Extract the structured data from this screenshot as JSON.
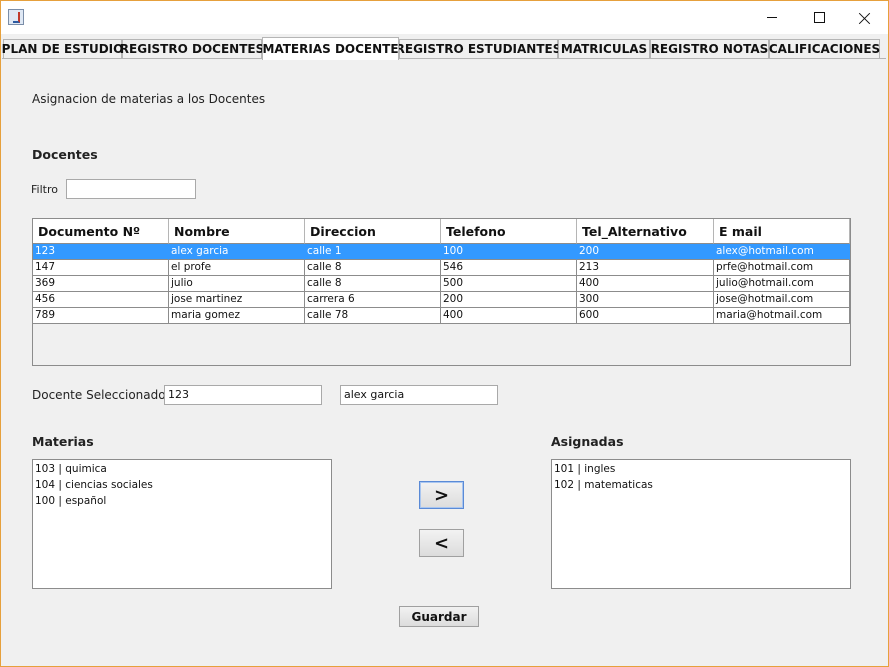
{
  "tabs": [
    {
      "label": "PLAN DE ESTUDIO",
      "active": false
    },
    {
      "label": "REGISTRO DOCENTES",
      "active": false
    },
    {
      "label": "MATERIAS DOCENTE",
      "active": true
    },
    {
      "label": "REGISTRO ESTUDIANTES",
      "active": false
    },
    {
      "label": "MATRICULAS",
      "active": false
    },
    {
      "label": "REGISTRO NOTAS",
      "active": false
    },
    {
      "label": "CALIFICACIONES",
      "active": false
    }
  ],
  "header": {
    "description": "Asignacion de materias a los Docentes",
    "docentes_label": "Docentes",
    "filter_label": "Filtro",
    "filter_value": ""
  },
  "table": {
    "columns": [
      "Documento Nº",
      "Nombre",
      "Direccion",
      "Telefono",
      "Tel_Alternativo",
      "E mail"
    ],
    "rows": [
      [
        "123",
        "alex garcia",
        "calle 1",
        "100",
        "200",
        "alex@hotmail.com"
      ],
      [
        "147",
        "el profe",
        "calle 8",
        "546",
        "213",
        "prfe@hotmail.com"
      ],
      [
        "369",
        "julio",
        "calle 8",
        "500",
        "400",
        "julio@hotmail.com"
      ],
      [
        "456",
        "jose martinez",
        "carrera 6",
        "200",
        "300",
        "jose@hotmail.com"
      ],
      [
        "789",
        "maria gomez",
        "calle 78",
        "400",
        "600",
        "maria@hotmail.com"
      ]
    ],
    "selected_row": 0
  },
  "selected": {
    "label": "Docente Seleccionado",
    "document": "123",
    "name": "alex garcia"
  },
  "materias": {
    "label": "Materias",
    "items": [
      "103 | quimica",
      "104 | ciencias sociales",
      "100 | español"
    ]
  },
  "asignadas": {
    "label": "Asignadas",
    "items": [
      "101 | ingles",
      "102 | matematicas"
    ]
  },
  "buttons": {
    "assign": ">",
    "unassign": "<",
    "save": "Guardar"
  }
}
